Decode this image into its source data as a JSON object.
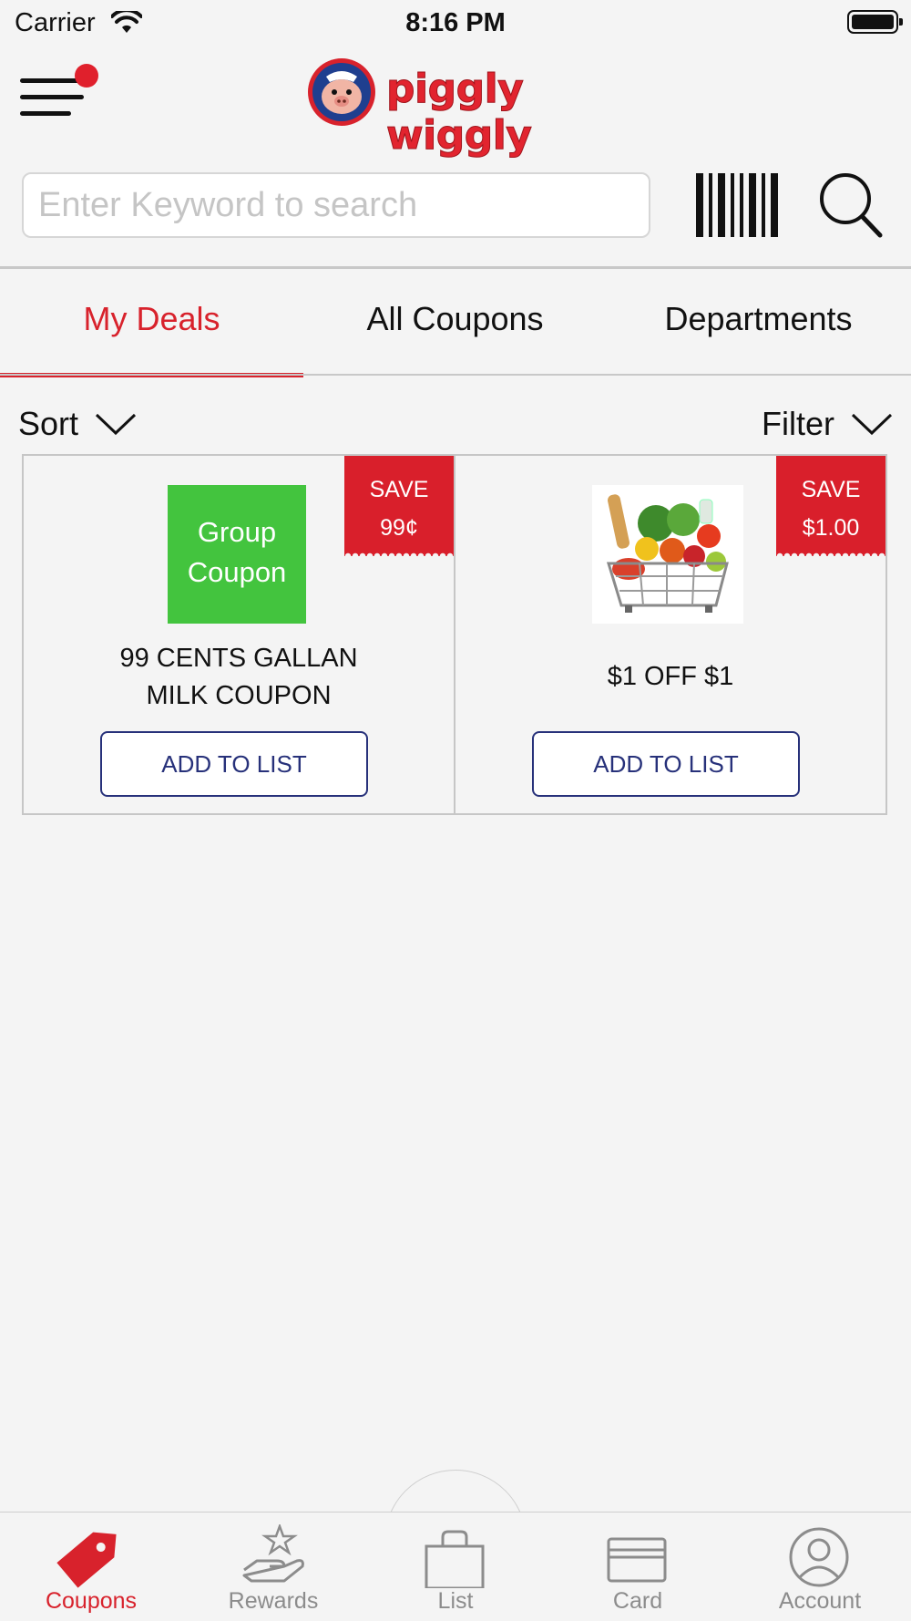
{
  "status_bar": {
    "carrier": "Carrier",
    "time": "8:16 PM"
  },
  "header": {
    "logo_text": "piggly wiggly",
    "notification_dot_color": "#e0202c"
  },
  "search": {
    "placeholder": "Enter Keyword to search",
    "value": ""
  },
  "tabs": [
    {
      "label": "My Deals",
      "active": true
    },
    {
      "label": "All Coupons",
      "active": false
    },
    {
      "label": "Departments",
      "active": false
    }
  ],
  "controls": {
    "sort_label": "Sort",
    "filter_label": "Filter"
  },
  "coupons": [
    {
      "save_label": "SAVE",
      "save_amount": "99¢",
      "image_text_line1": "Group",
      "image_text_line2": "Coupon",
      "title_line1": "99 CENTS GALLAN",
      "title_line2": "MILK COUPON",
      "button_label": "ADD TO LIST"
    },
    {
      "save_label": "SAVE",
      "save_amount": "$1.00",
      "title": "$1 OFF $1",
      "button_label": "ADD TO LIST"
    }
  ],
  "bottom_nav": [
    {
      "label": "Coupons",
      "icon": "tag-icon",
      "active": true
    },
    {
      "label": "Rewards",
      "icon": "rewards-hand-star-icon",
      "active": false
    },
    {
      "label": "List",
      "icon": "bag-icon",
      "active": false
    },
    {
      "label": "Card",
      "icon": "card-icon",
      "active": false
    },
    {
      "label": "Account",
      "icon": "account-icon",
      "active": false
    }
  ],
  "colors": {
    "accent": "#d8222c",
    "button_border": "#27317a",
    "group_coupon_bg": "#43c43e",
    "badge_bg": "#d91f2b",
    "inactive_nav": "#8c8c8c"
  }
}
